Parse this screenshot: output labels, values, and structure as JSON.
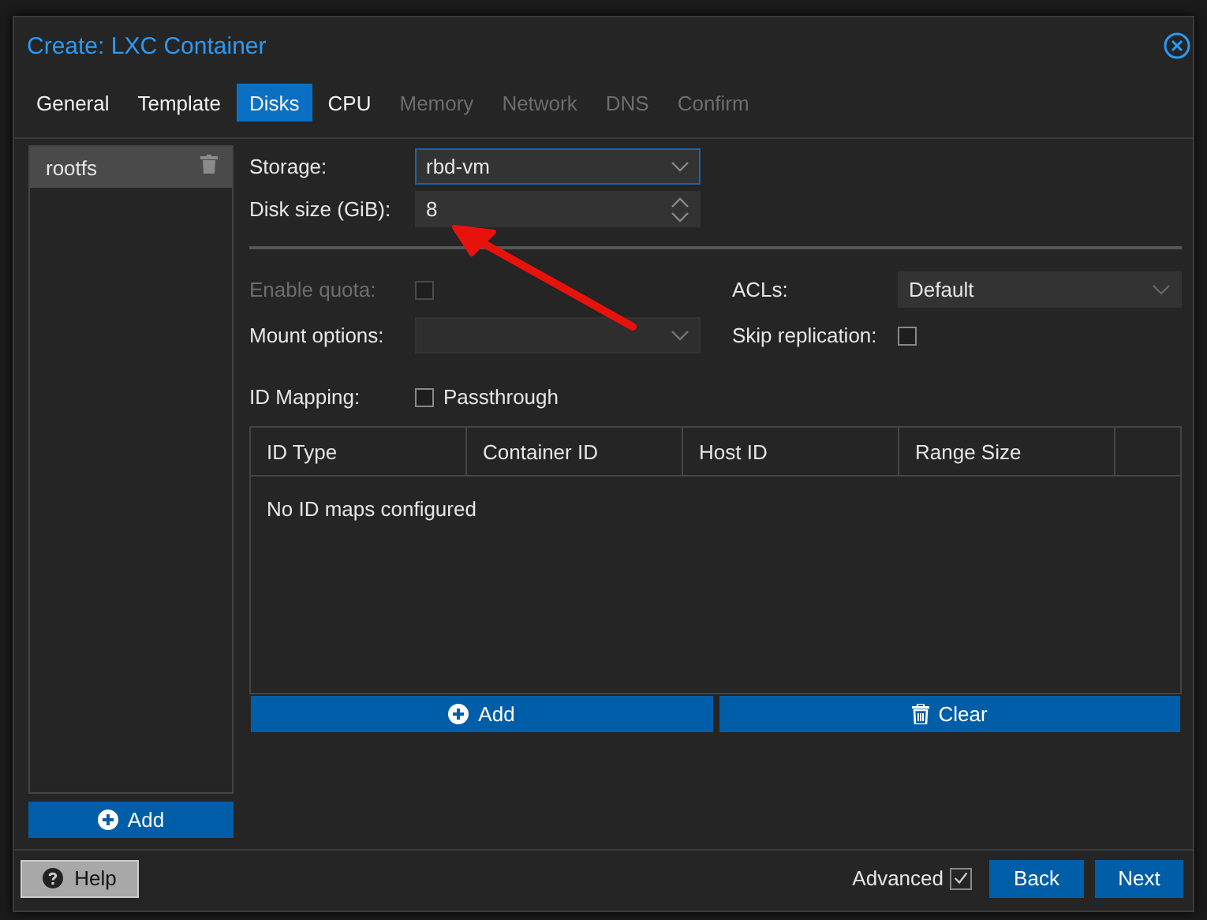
{
  "window": {
    "title": "Create: LXC Container"
  },
  "tabs": [
    {
      "label": "General",
      "selected": false,
      "disabled": false
    },
    {
      "label": "Template",
      "selected": false,
      "disabled": false
    },
    {
      "label": "Disks",
      "selected": true,
      "disabled": false
    },
    {
      "label": "CPU",
      "selected": false,
      "disabled": false
    },
    {
      "label": "Memory",
      "selected": false,
      "disabled": true
    },
    {
      "label": "Network",
      "selected": false,
      "disabled": true
    },
    {
      "label": "DNS",
      "selected": false,
      "disabled": true
    },
    {
      "label": "Confirm",
      "selected": false,
      "disabled": true
    }
  ],
  "disk_list": {
    "items": [
      {
        "label": "rootfs",
        "selected": true
      }
    ],
    "add_button": "Add"
  },
  "form": {
    "storage": {
      "label": "Storage:",
      "value": "rbd-vm"
    },
    "disk_size": {
      "label": "Disk size (GiB):",
      "value": "8"
    },
    "enable_quota": {
      "label": "Enable quota:",
      "checked": false,
      "disabled": true
    },
    "acls": {
      "label": "ACLs:",
      "value": "Default"
    },
    "mount_options": {
      "label": "Mount options:"
    },
    "skip_replication": {
      "label": "Skip replication:",
      "checked": false
    },
    "id_mapping": {
      "label": "ID Mapping:",
      "checkbox_label": "Passthrough",
      "checked": false
    }
  },
  "id_table": {
    "columns": [
      "ID Type",
      "Container ID",
      "Host ID",
      "Range Size"
    ],
    "empty_text": "No ID maps configured",
    "add_button": "Add",
    "clear_button": "Clear"
  },
  "footer": {
    "help": "Help",
    "advanced": {
      "label": "Advanced",
      "checked": true
    },
    "back": "Back",
    "next": "Next"
  }
}
